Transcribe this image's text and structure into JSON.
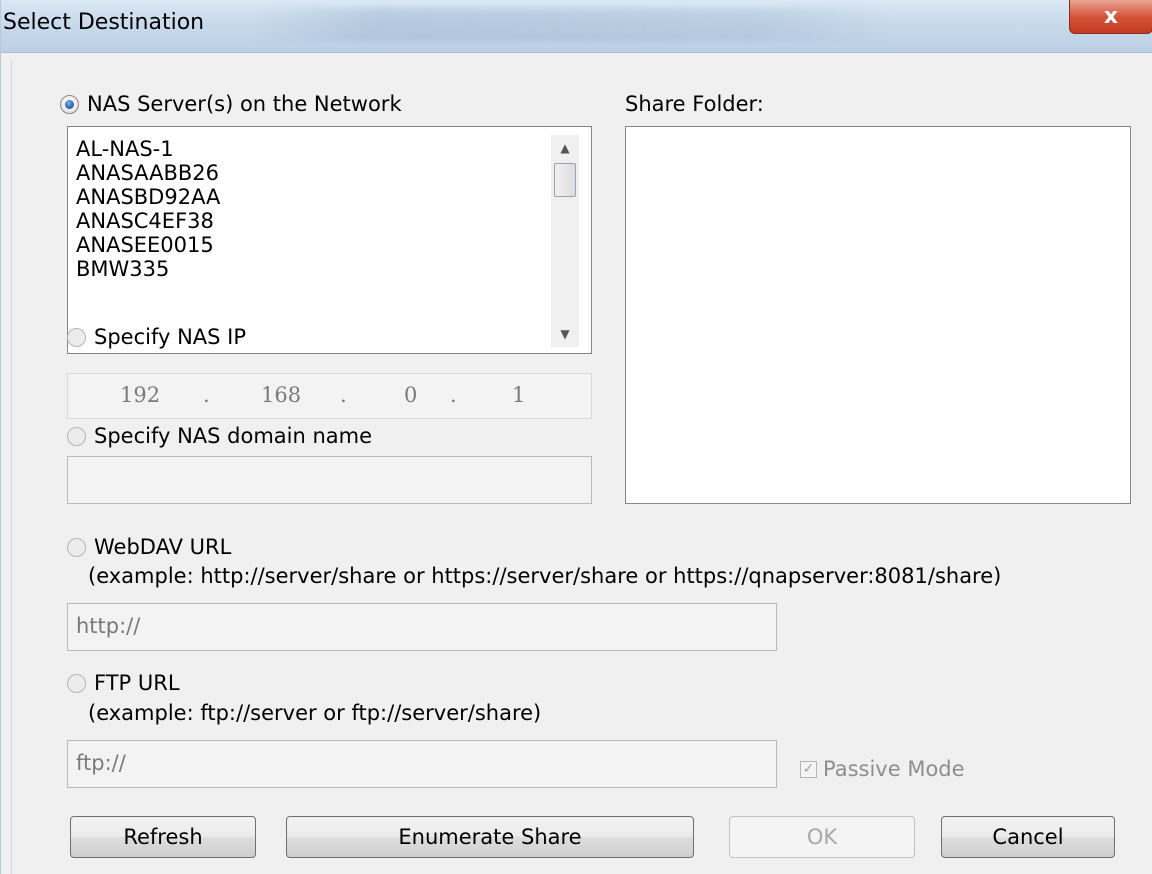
{
  "window": {
    "title": "Select Destination",
    "close_glyph": "x"
  },
  "nas_servers": {
    "radio_label": "NAS Server(s) on the Network",
    "selected": true,
    "items": [
      "AL-NAS-1",
      "ANASAABB26",
      "ANASBD92AA",
      "ANASC4EF38",
      "ANASEE0015",
      "BMW335"
    ]
  },
  "share_folder": {
    "label": "Share Folder:"
  },
  "nas_ip": {
    "radio_label": "Specify NAS IP",
    "octets": [
      "192",
      "168",
      "0",
      "1"
    ],
    "separator": "."
  },
  "nas_domain": {
    "radio_label": "Specify NAS domain name",
    "value": ""
  },
  "webdav": {
    "radio_label": "WebDAV URL",
    "example": "(example: http://server/share or https://server/share or https://qnapserver:8081/share)",
    "value": "http://"
  },
  "ftp": {
    "radio_label": "FTP URL",
    "example": "(example: ftp://server or ftp://server/share)",
    "value": "ftp://",
    "passive_mode_label": "Passive Mode",
    "passive_mode_checked": true
  },
  "buttons": {
    "refresh": "Refresh",
    "enumerate": "Enumerate Share",
    "ok": "OK",
    "cancel": "Cancel"
  },
  "icons": {
    "scroll_up": "▲",
    "scroll_down": "▼",
    "check": "✓"
  }
}
